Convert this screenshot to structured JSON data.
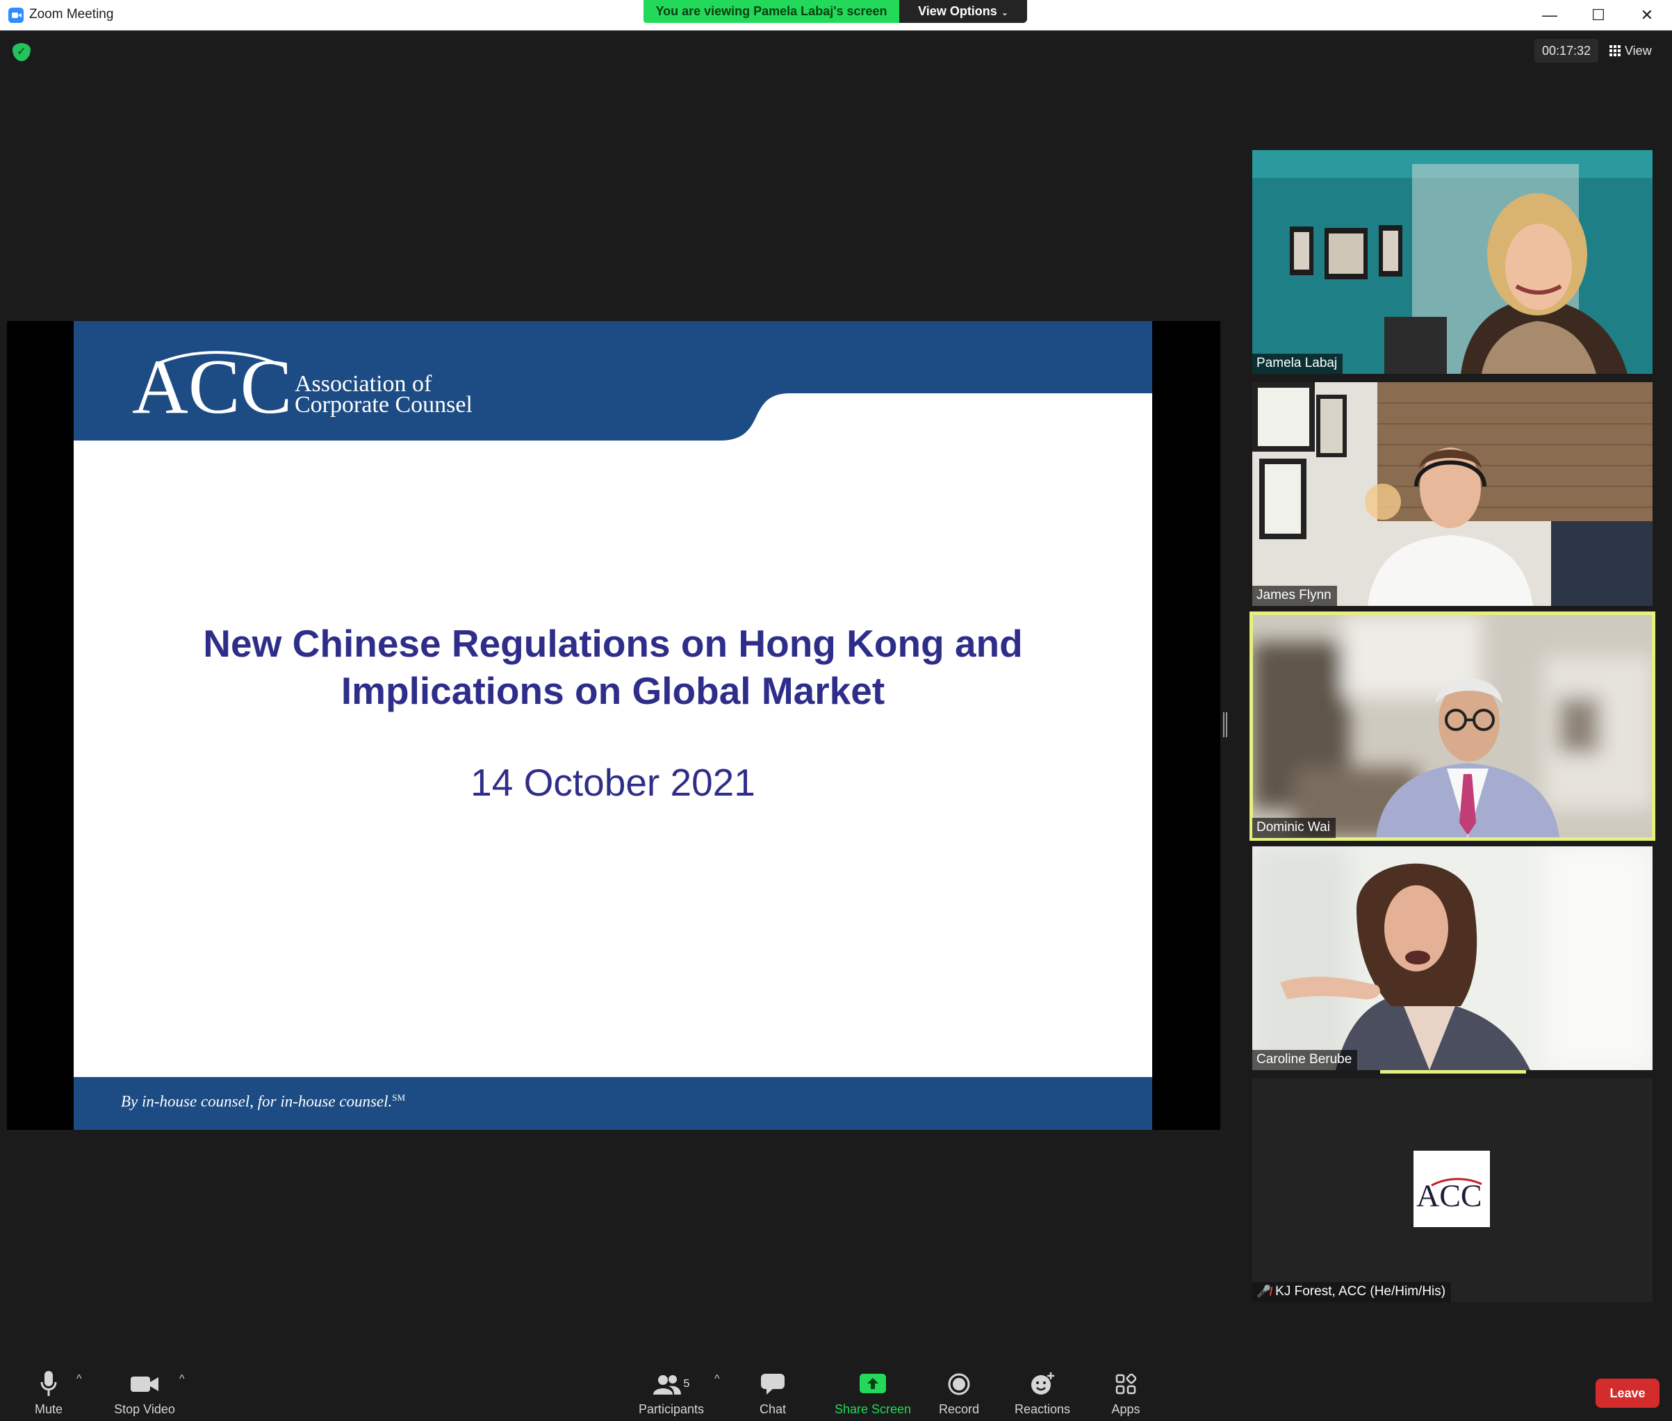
{
  "window": {
    "title": "Zoom Meeting",
    "minimize": "—",
    "maximize": "☐",
    "close": "✕"
  },
  "banner": {
    "viewing_text": "You are viewing Pamela Labaj's screen",
    "view_options_label": "View Options"
  },
  "meeting": {
    "timer": "00:17:32",
    "view_label": "View"
  },
  "slide": {
    "logo_letters": "ACC",
    "org_line1": "Association of",
    "org_line2": "Corporate Counsel",
    "title_line1": "New Chinese Regulations on Hong Kong and",
    "title_line2": "Implications on Global Market",
    "date": "14 October 2021",
    "tagline": "By in-house counsel, for in-house counsel.",
    "tagline_mark": "SM",
    "colors": {
      "brand_blue": "#1d4c84",
      "title_text": "#2e2e8a",
      "logo_red": "#c21f2a"
    }
  },
  "participants": [
    {
      "name": "Pamela Labaj",
      "active": false
    },
    {
      "name": "James Flynn",
      "active": false
    },
    {
      "name": "Dominic Wai",
      "active": true
    },
    {
      "name": "Caroline Berube",
      "active": false
    },
    {
      "name": "KJ Forest, ACC (He/Him/His)",
      "active": false,
      "muted": true,
      "avatar": "ACC"
    }
  ],
  "toolbar": {
    "mute": "Mute",
    "stop_video": "Stop Video",
    "participants": "Participants",
    "participants_count": "5",
    "chat": "Chat",
    "share_screen": "Share Screen",
    "record": "Record",
    "reactions": "Reactions",
    "apps": "Apps",
    "leave": "Leave"
  },
  "colors": {
    "background": "#1b1b1b",
    "share_green": "#23d959",
    "active_speaker": "#e6f07a",
    "leave_red": "#d42c2c"
  }
}
